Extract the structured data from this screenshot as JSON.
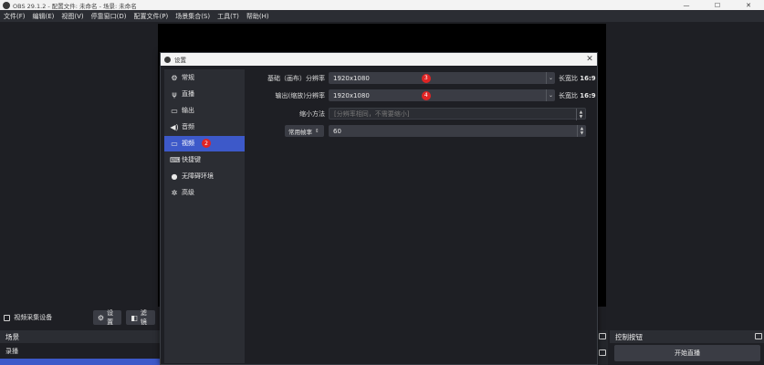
{
  "window": {
    "title": "OBS 29.1.2 - 配置文件: 未命名 - 场景: 未命名",
    "minimize": "—",
    "maximize": "☐",
    "close": "✕"
  },
  "menu": [
    "文件(F)",
    "编辑(E)",
    "视图(V)",
    "停靠窗口(D)",
    "配置文件(P)",
    "场景集合(S)",
    "工具(T)",
    "帮助(H)"
  ],
  "toolbar": {
    "source_label": "视频采集设备",
    "settings_label": "设置",
    "filters_label": "滤镜"
  },
  "docks": {
    "scenes_title": "场景",
    "scene_item": "录播",
    "controls_title": "控制按钮",
    "start_stream": "开始直播"
  },
  "dialog": {
    "title": "设置",
    "close": "✕",
    "nav": [
      {
        "label": "常规",
        "icon": "gear-icon",
        "glyph": "⚙"
      },
      {
        "label": "直播",
        "icon": "antenna-icon",
        "glyph": "📡"
      },
      {
        "label": "输出",
        "icon": "output-icon",
        "glyph": "⎚"
      },
      {
        "label": "音频",
        "icon": "speaker-icon",
        "glyph": "🔈"
      },
      {
        "label": "视频",
        "icon": "monitor-icon",
        "glyph": "🖵",
        "active": true,
        "badge": "2"
      },
      {
        "label": "快捷键",
        "icon": "keyboard-icon",
        "glyph": "⌨"
      },
      {
        "label": "无障碍环境",
        "icon": "accessibility-icon",
        "glyph": "♿"
      },
      {
        "label": "高级",
        "icon": "wrench-icon",
        "glyph": "✲"
      }
    ],
    "video": {
      "base_label": "基础（画布）分辨率",
      "base_value": "1920x1080",
      "base_badge": "3",
      "base_aspect_label": "长宽比",
      "base_aspect_value": "16:9",
      "output_label": "输出(缩放)分辨率",
      "output_value": "1920x1080",
      "output_badge": "4",
      "output_aspect_label": "长宽比",
      "output_aspect_value": "16:9",
      "downscale_label": "缩小方法",
      "downscale_value": "[分辨率相同，不需要缩小]",
      "fps_type_label": "常用帧率",
      "fps_value": "60"
    }
  }
}
